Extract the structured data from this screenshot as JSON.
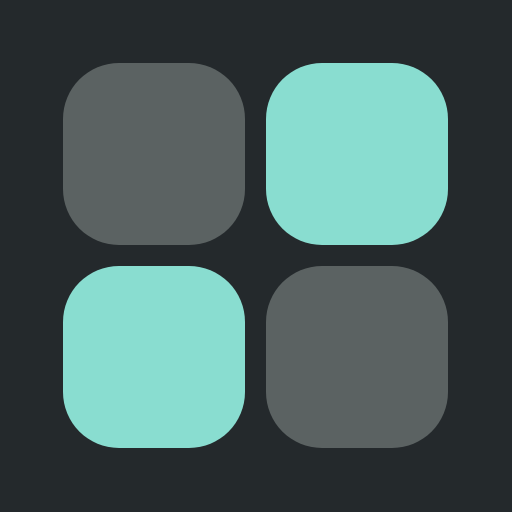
{
  "icon": {
    "name": "app-grid-icon",
    "background_color": "#24292c",
    "tiles": [
      {
        "name": "tile-top-left",
        "state": "inactive",
        "color": "#5b6262"
      },
      {
        "name": "tile-top-right",
        "state": "active",
        "color": "#89ddd0"
      },
      {
        "name": "tile-bottom-left",
        "state": "active",
        "color": "#89ddd0"
      },
      {
        "name": "tile-bottom-right",
        "state": "inactive",
        "color": "#5b6262"
      }
    ]
  }
}
